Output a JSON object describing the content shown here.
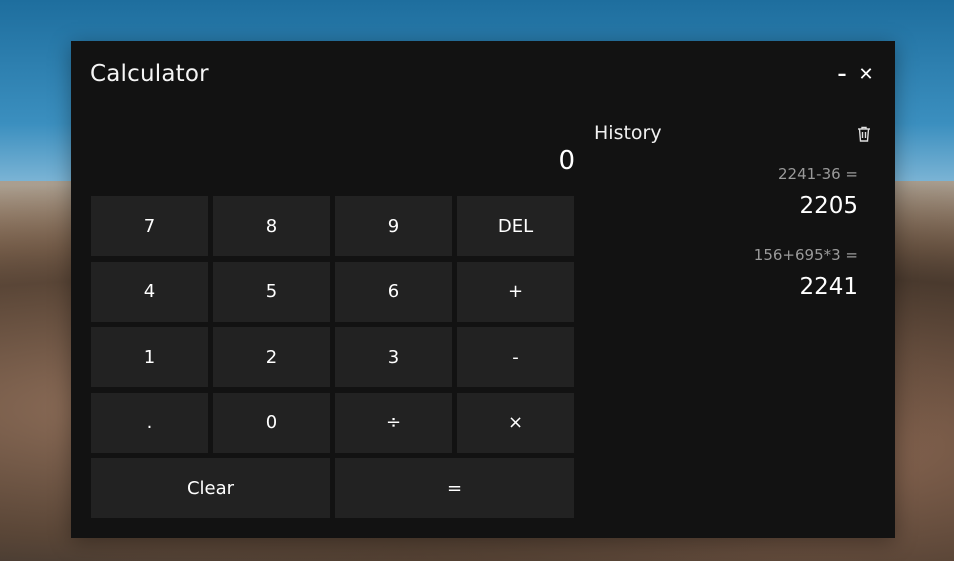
{
  "app": {
    "title": "Calculator"
  },
  "window_controls": {
    "minimize_symbol": "–",
    "close_symbol": "✕"
  },
  "display": {
    "value": "0"
  },
  "keypad": {
    "keys": [
      "7",
      "8",
      "9",
      "DEL",
      "4",
      "5",
      "6",
      "+",
      "1",
      "2",
      "3",
      "-",
      ".",
      "0",
      "÷",
      "×",
      "Clear",
      "="
    ]
  },
  "history": {
    "title": "History",
    "entries": [
      {
        "expression": "2241-36 =",
        "result": "2205"
      },
      {
        "expression": "156+695*3 =",
        "result": "2241"
      }
    ]
  },
  "icons": {
    "trash": "trash-icon"
  },
  "colors": {
    "window_bg": "#121212",
    "key_bg": "#222222",
    "text": "#ffffff",
    "muted_text": "#9a9a9a"
  }
}
